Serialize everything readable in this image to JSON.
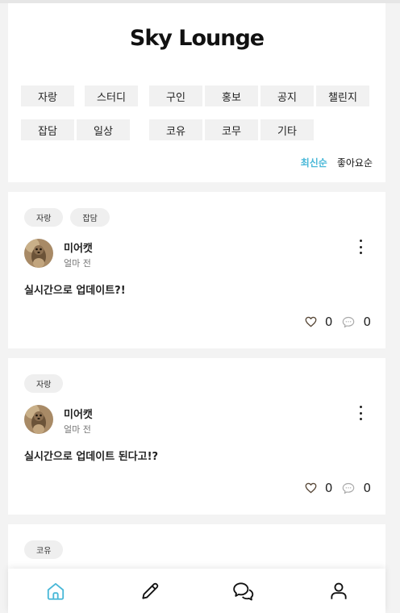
{
  "header": {
    "title": "Sky Lounge",
    "categories": [
      "자랑",
      "스터디",
      "구인",
      "홍보",
      "공지",
      "챌린지",
      "잡담",
      "일상",
      "코유",
      "코무",
      "기타"
    ],
    "sort_latest": "최신순",
    "sort_likes": "좋아요순"
  },
  "posts": [
    {
      "tags": [
        "자랑",
        "잡담"
      ],
      "author": "미어캣",
      "time": "얼마 전",
      "text": "실시간으로 업데이트?!",
      "likes": "0",
      "comments": "0"
    },
    {
      "tags": [
        "자랑"
      ],
      "author": "미어캣",
      "time": "얼마 전",
      "text": "실시간으로 업데이트 된다고!?",
      "likes": "0",
      "comments": "0"
    },
    {
      "tags": [
        "코유"
      ]
    }
  ],
  "nav": {
    "items": [
      "home-icon",
      "pencil-icon",
      "chat-icon",
      "user-icon"
    ],
    "active": "home-icon"
  },
  "colors": {
    "accent": "#49b8d8",
    "background": "#f3f3f3"
  }
}
